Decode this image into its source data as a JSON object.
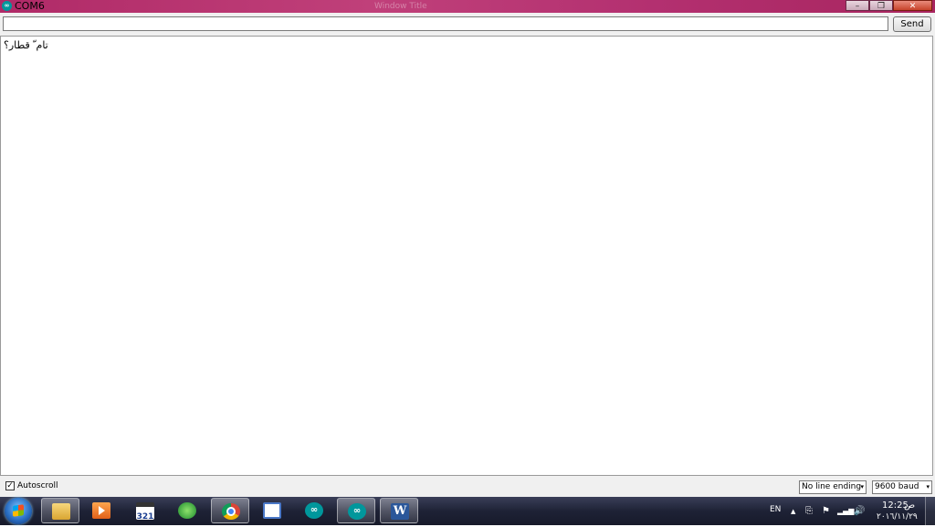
{
  "window": {
    "title": "COM6",
    "app_icon_glyph": "∞",
    "background_title": "Window Title",
    "buttons": {
      "minimize": "–",
      "restore": "❐",
      "close": "✕"
    }
  },
  "input": {
    "value": "",
    "send_label": "Send"
  },
  "output": {
    "text": "تام ّ قطار؟"
  },
  "bottom": {
    "autoscroll_label": "Autoscroll",
    "autoscroll_checked": "✓",
    "line_ending": "No line ending",
    "baud": "9600 baud",
    "dropdown_arrow": "▾"
  },
  "taskbar": {
    "items": [
      {
        "name": "file-explorer",
        "icon": "folder-icon"
      },
      {
        "name": "media-player",
        "icon": "play-icon"
      },
      {
        "name": "video-app",
        "icon": "clapperboard-icon",
        "label": "321"
      },
      {
        "name": "download-manager",
        "icon": "globe-download-icon"
      },
      {
        "name": "chrome",
        "icon": "chrome-icon",
        "active": true
      },
      {
        "name": "window",
        "icon": "window-icon"
      },
      {
        "name": "arduino-1",
        "icon": "arduino-icon",
        "glyph": "∞"
      },
      {
        "name": "arduino-2",
        "icon": "arduino-icon",
        "glyph": "∞",
        "active": true
      },
      {
        "name": "word",
        "icon": "word-icon",
        "glyph": "W",
        "active": true
      }
    ],
    "language": "EN",
    "time": "12:25",
    "ampm": "ص",
    "date": "٢٠١٦/١١/٢٩",
    "tray_glyphs": {
      "arrow": "▲",
      "flag": "⚑",
      "signal": "▂▄▆",
      "speaker": "🔊",
      "network": "⎘"
    }
  },
  "colors": {
    "titlebar": "#b02a67",
    "arduino": "#00979c",
    "taskbar": "#1e2236"
  }
}
